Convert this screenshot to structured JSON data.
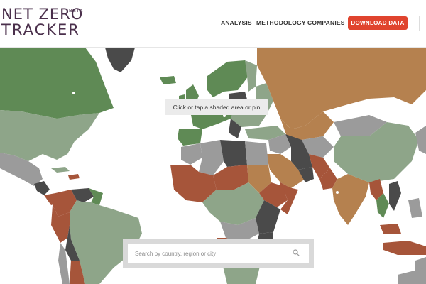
{
  "logo": {
    "line1": "NET ZERO",
    "line2": "TRACKER",
    "badge": "BETA"
  },
  "nav": {
    "analysis": "ANALYSIS",
    "methodology": "METHODOLOGY",
    "companies": "COMPANIES"
  },
  "cta": {
    "download": "DOWNLOAD DATA"
  },
  "map": {
    "hint": "Click or tap a shaded area or pin"
  },
  "search": {
    "placeholder": "Search by country, region or city",
    "icon": "search-icon"
  },
  "colors": {
    "green": "#5f8a55",
    "sage": "#8ea589",
    "brown": "#b5814f",
    "rust": "#a6553a",
    "grey": "#9b9b9b",
    "dark": "#4a4a4a",
    "accent": "#e0442e"
  }
}
